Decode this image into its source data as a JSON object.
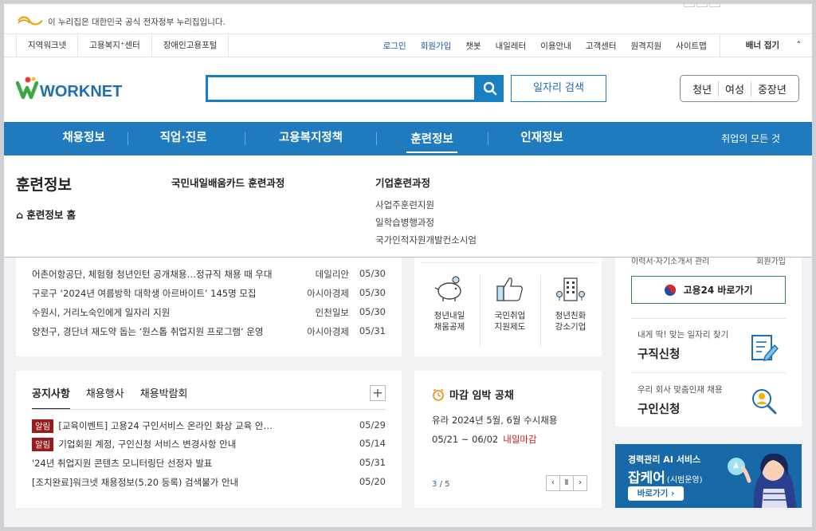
{
  "gov_banner": {
    "text": "이 누리집은 대한민국 공식 전자정부 누리집입니다."
  },
  "util": {
    "left": [
      "지역워크넷",
      "고용복지⁺센터",
      "장애인고용포털"
    ],
    "right": [
      "로그인",
      "회원가입",
      "챗봇",
      "내일레터",
      "이용안내",
      "고객센터",
      "원격지원",
      "사이트맵"
    ],
    "fold": "배너 접기"
  },
  "header": {
    "brand": "WORKNET",
    "job_search_button": "일자리 검색",
    "targets": [
      "청년",
      "여성",
      "중장년"
    ]
  },
  "gnb": {
    "items": [
      "채용정보",
      "직업·진로",
      "고용복지정책",
      "훈련정보",
      "인재정보"
    ],
    "all": "취업의 모든 것"
  },
  "mega": {
    "title": "훈련정보",
    "home": "훈련정보 홈",
    "col1": "국민내일배움카드 훈련과정",
    "col2_head": "기업훈련과정",
    "col2_items": [
      "사업주훈련지원",
      "일학습병행과정",
      "국가인적자원개발컨소시엄"
    ]
  },
  "news": [
    {
      "title": "어촌어항공단, 체험형 청년인턴 공개채용…정규직 채용 때 우대",
      "source": "데일리안",
      "date": "05/30"
    },
    {
      "title": "구로구 ‘2024년 여름방학 대학생 아르바이트’ 145명 모집",
      "source": "아시아경제",
      "date": "05/30"
    },
    {
      "title": "수원시, 거리노숙인에게 일자리 지원",
      "source": "인천일보",
      "date": "05/30"
    },
    {
      "title": "양천구, 경단녀 재도약 돕는 ‘원스톱 취업지원 프로그램’ 운영",
      "source": "아시아경제",
      "date": "05/31"
    }
  ],
  "support": {
    "cells": [
      {
        "label1": "청년내일",
        "label2": "채움공제"
      },
      {
        "label1": "국민취업",
        "label2": "지원제도"
      },
      {
        "label1": "청년친화",
        "label2": "강소기업"
      }
    ]
  },
  "right": {
    "cut_left": "이력서·자기소개서 관리",
    "cut_right": "회원가입",
    "g24": "고용24 바로가기",
    "job_small": "내게 딱! 맞는 일자리 찾기",
    "job_large": "구직신청",
    "hire_small": "우리 회사 맞춤인재 채용",
    "hire_large": "구인신청"
  },
  "notice": {
    "tabs": [
      "공지사항",
      "채용행사",
      "채용박람회"
    ],
    "plus": "+",
    "rows": [
      {
        "badge": "알림",
        "title": "[교육이벤트] 고용24 구인서비스 온라인 화상 교육 안…",
        "date": "05/29"
      },
      {
        "badge": "알림",
        "title": "기업회원 계정, 구인신청 서비스 변경사항 안내",
        "date": "05/14"
      },
      {
        "badge": "",
        "title": "'24년 취업지원 콘텐츠 모니터링단 선정자 발표",
        "date": "05/31"
      },
      {
        "badge": "",
        "title": "[조치완료]워크넷 채용정보(5.20 등록) 검색불가 안내",
        "date": "05/20"
      }
    ]
  },
  "deadline": {
    "title": "마감 임박 공채",
    "line1": "유라  2024년 5월, 6월 수시채용",
    "line2": "05/21 ~ 06/02",
    "tag": "내일마감",
    "page_current": "3",
    "page_total": "/ 5",
    "ctl": [
      "‹",
      "Ⅱ",
      "›"
    ]
  },
  "ad": {
    "line1": "경력관리 AI 서비스",
    "line2": "잡케어",
    "line2_small": "(시범운영)",
    "button": "바로가기 ›"
  },
  "colors": {
    "primary": "#1f7bbd",
    "accent_red": "#9d1a1a",
    "green": "#2c8a4a"
  }
}
